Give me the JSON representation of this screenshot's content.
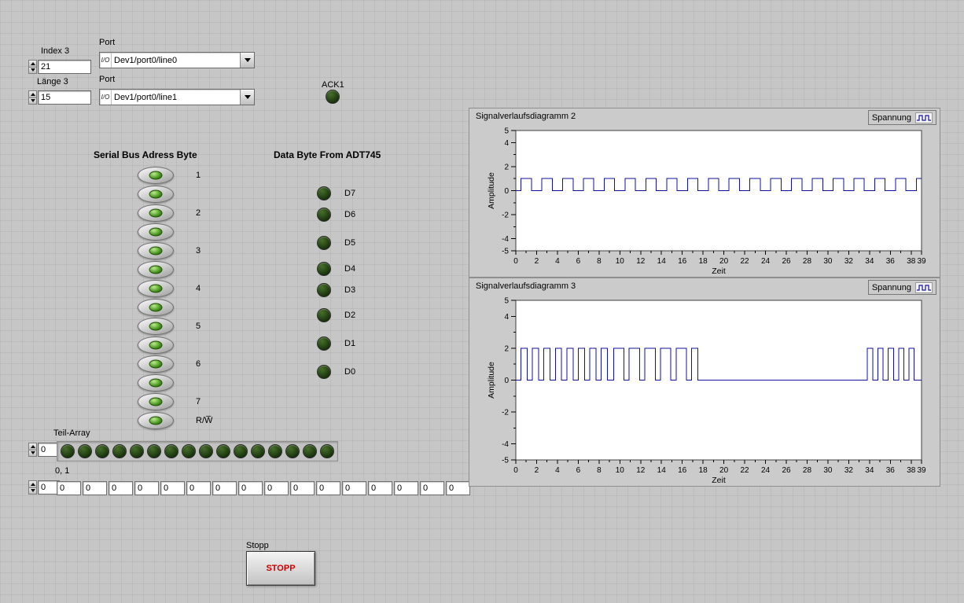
{
  "controls": {
    "index3": {
      "label": "Index 3",
      "value": "21"
    },
    "laenge3": {
      "label": "Länge 3",
      "value": "15"
    },
    "port0": {
      "label": "Port",
      "glyph": "I/O",
      "value": "Dev1/port0/line0"
    },
    "port1": {
      "label": "Port",
      "glyph": "I/O",
      "value": "Dev1/port0/line1"
    },
    "ack1_label": "ACK1"
  },
  "serial_bus": {
    "title": "Serial Bus Adress Byte",
    "button_count": 14,
    "row_labels": {
      "0": "1",
      "2": "2",
      "4": "3",
      "6": "4",
      "8": "5",
      "10": "6",
      "12": "7",
      "13": "R/W̅"
    }
  },
  "data_byte": {
    "title": "Data Byte From ADT745",
    "leds": [
      "D7",
      "D6",
      "D5",
      "D4",
      "D3",
      "D2",
      "D1",
      "D0"
    ]
  },
  "teil_array": {
    "label": "Teil-Array",
    "index_value": "0",
    "led_count": 16
  },
  "bit_values_array": {
    "label": "0, 1",
    "index_value": "0",
    "values": [
      "0",
      "0",
      "0",
      "0",
      "0",
      "0",
      "0",
      "0",
      "0",
      "0",
      "0",
      "0",
      "0",
      "0",
      "0",
      "0"
    ]
  },
  "stop": {
    "label": "Stopp",
    "button_label": "STOPP",
    "text_color": "#cc0000"
  },
  "colors": {
    "signal_blue": "#12129e",
    "led_off_green": "#1e3a0e",
    "panel_gray": "#c6c6c6"
  },
  "chart_data": [
    {
      "type": "line",
      "waveform": "digital-step",
      "title": "Signalverlaufsdiagramm 2",
      "legend": [
        {
          "name": "Spannung",
          "icon": "square-wave-icon",
          "color": "#12129e"
        }
      ],
      "legend_position": "top-right",
      "xlabel": "Zeit",
      "ylabel": "Amplitude",
      "xlim": [
        0,
        39
      ],
      "ylim": [
        -5,
        5
      ],
      "xticks_major": [
        0,
        2,
        4,
        6,
        8,
        10,
        12,
        14,
        16,
        18,
        20,
        22,
        24,
        26,
        28,
        30,
        32,
        34,
        36,
        38,
        39
      ],
      "xticks_minor": [
        1,
        3,
        5,
        7,
        9,
        11,
        13,
        15,
        17,
        19,
        21,
        23,
        25,
        27,
        29,
        31,
        33,
        35,
        37
      ],
      "yticks_major": [
        5,
        4,
        2,
        0,
        -2,
        -4,
        -5
      ],
      "yticks_minor": [
        3,
        1,
        -1,
        -3
      ],
      "grid": false,
      "series": [
        {
          "name": "Spannung",
          "color": "#12129e",
          "levels": [
            0,
            1
          ],
          "initial_level_index": 0,
          "transition_times": [
            0.5,
            1.5,
            2.5,
            3.5,
            4.5,
            5.5,
            6.5,
            7.5,
            8.5,
            9.5,
            10.5,
            11.5,
            12.5,
            13.5,
            14.5,
            15.5,
            16.5,
            17.5,
            18.5,
            19.5,
            20.5,
            21.5,
            22.5,
            23.5,
            24.5,
            25.5,
            26.5,
            27.5,
            28.5,
            29.5,
            30.5,
            31.5,
            32.5,
            33.5,
            34.5,
            35.5,
            36.5,
            37.5,
            38.5
          ]
        }
      ]
    },
    {
      "type": "line",
      "waveform": "digital-step",
      "title": "Signalverlaufsdiagramm 3",
      "legend": [
        {
          "name": "Spannung",
          "icon": "square-wave-icon",
          "color": "#12129e"
        }
      ],
      "legend_position": "top-right",
      "xlabel": "Zeit",
      "ylabel": "Amplitude",
      "xlim": [
        0,
        39
      ],
      "ylim": [
        -5,
        5
      ],
      "xticks_major": [
        0,
        2,
        4,
        6,
        8,
        10,
        12,
        14,
        16,
        18,
        20,
        22,
        24,
        26,
        28,
        30,
        32,
        34,
        36,
        38,
        39
      ],
      "xticks_minor": [
        1,
        3,
        5,
        7,
        9,
        11,
        13,
        15,
        17,
        19,
        21,
        23,
        25,
        27,
        29,
        31,
        33,
        35,
        37
      ],
      "yticks_major": [
        5,
        4,
        2,
        0,
        -2,
        -4,
        -5
      ],
      "yticks_minor": [
        3,
        1,
        -1,
        -3
      ],
      "grid": false,
      "series": [
        {
          "name": "Spannung",
          "color": "#12129e",
          "levels": [
            0,
            2
          ],
          "initial_level_index": 0,
          "transition_times": [
            0.5,
            1.1,
            1.6,
            2.2,
            2.7,
            3.3,
            3.8,
            4.4,
            4.9,
            5.5,
            6.0,
            6.6,
            7.1,
            7.7,
            8.2,
            8.8,
            9.4,
            10.4,
            10.9,
            11.9,
            12.4,
            13.4,
            13.9,
            14.9,
            15.4,
            16.4,
            16.9,
            17.5,
            33.8,
            34.3,
            34.8,
            35.3,
            35.8,
            36.3,
            36.8,
            37.3,
            37.8,
            38.3
          ]
        }
      ]
    }
  ]
}
